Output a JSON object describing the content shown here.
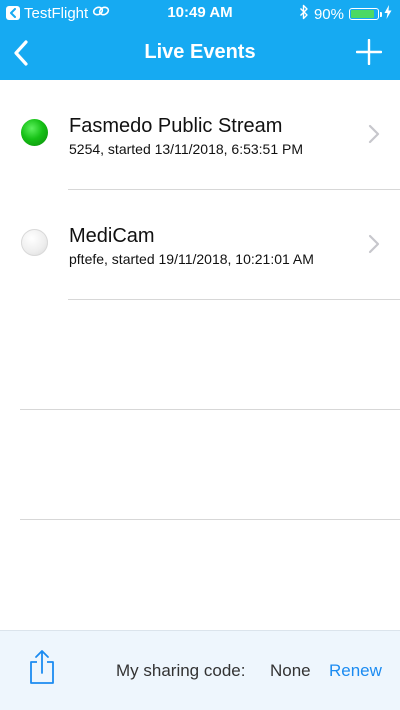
{
  "status_bar": {
    "back_app": "TestFlight",
    "time": "10:49 AM",
    "battery": "90%",
    "battery_level": 0.9,
    "icons": [
      "back-arrow-icon",
      "link-icon",
      "bluetooth-icon",
      "battery-icon",
      "charging-bolt-icon"
    ]
  },
  "nav": {
    "title": "Live Events",
    "back_icon": "chevron-left-icon",
    "add_icon": "plus-icon"
  },
  "events": [
    {
      "title": "Fasmedo Public Stream",
      "subtitle": "5254, started 13/11/2018, 6:53:51 PM",
      "status": "live",
      "status_color": "#16c116"
    },
    {
      "title": "MediCam",
      "subtitle": "pftefe, started 19/11/2018, 10:21:01 AM",
      "status": "idle",
      "status_color": "#e6e6e6"
    }
  ],
  "footer": {
    "share_icon": "share-icon",
    "sharing_label": "My sharing code:",
    "sharing_value": "None",
    "renew_label": "Renew"
  },
  "colors": {
    "header": "#16aaf2",
    "accent": "#1b8bf1",
    "footer_bg": "#eef6fd"
  }
}
